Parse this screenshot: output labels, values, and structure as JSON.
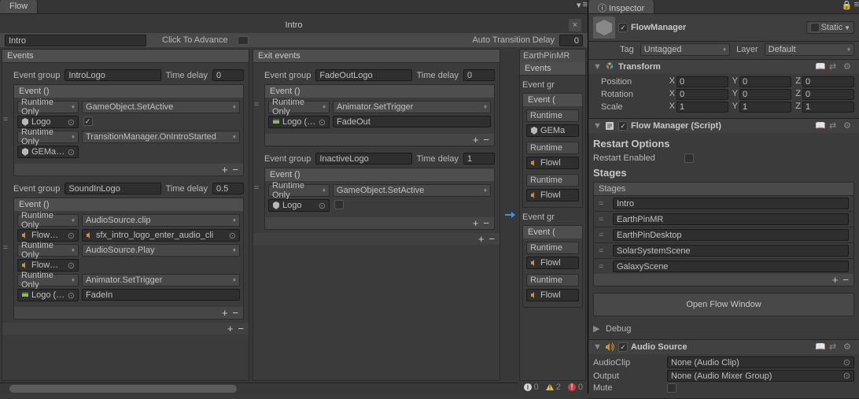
{
  "tabs": {
    "flow": "Flow",
    "inspector": "Inspector"
  },
  "flow": {
    "title": "Intro",
    "stage_name": "Intro",
    "click_advance_label": "Click To Advance",
    "auto_delay_label": "Auto Transition Delay",
    "auto_delay_value": "0",
    "events_header": "Events",
    "exit_events_header": "Exit events",
    "event_group_label": "Event group",
    "time_delay_label": "Time delay",
    "event_title": "Event ()",
    "runtime_only": "Runtime Only",
    "groups_left": [
      {
        "name": "IntroLogo",
        "delay": "0",
        "events": [
          {
            "func": "GameObject.SetActive",
            "obj": "Logo",
            "obj_icon": "cube",
            "param_type": "check",
            "param_checked": true
          },
          {
            "func": "TransitionManager.OnIntroStarted",
            "obj": "GEManage",
            "obj_icon": "cube",
            "param_type": "none"
          }
        ]
      },
      {
        "name": "SoundInLogo",
        "delay": "0.5",
        "events": [
          {
            "func": "AudioSource.clip",
            "obj": "FlowMana",
            "obj_icon": "audio",
            "param_type": "objref",
            "param": "sfx_intro_logo_enter_audio_cli",
            "param_icon": "audio"
          },
          {
            "func": "AudioSource.Play",
            "obj": "FlowMana",
            "obj_icon": "audio",
            "param_type": "none"
          },
          {
            "func": "Animator.SetTrigger",
            "obj": "Logo (Ani",
            "obj_icon": "anim",
            "param_type": "text",
            "param": "FadeIn"
          }
        ]
      }
    ],
    "groups_right": [
      {
        "name": "FadeOutLogo",
        "delay": "0",
        "events": [
          {
            "func": "Animator.SetTrigger",
            "obj": "Logo (Ani",
            "obj_icon": "anim",
            "param_type": "text",
            "param": "FadeOut"
          }
        ]
      },
      {
        "name": "InactiveLogo",
        "delay": "1",
        "events": [
          {
            "func": "GameObject.SetActive",
            "obj": "Logo",
            "obj_icon": "cube",
            "param_type": "check",
            "param_checked": false
          }
        ]
      }
    ],
    "partial": {
      "name": "EarthPinMR",
      "events_header": "Events",
      "event_gr": "Event gr",
      "event_title": "Event (",
      "runtime": "Runtime",
      "objs": [
        "GEMa",
        "Flowl",
        "Flowl",
        "Flowl",
        "Flowl"
      ]
    }
  },
  "status": {
    "info": "0",
    "warn": "2",
    "err": "0"
  },
  "inspector": {
    "name": "FlowManager",
    "static_label": "Static",
    "tag_label": "Tag",
    "tag_value": "Untagged",
    "layer_label": "Layer",
    "layer_value": "Default",
    "transform": {
      "title": "Transform",
      "position_label": "Position",
      "rotation_label": "Rotation",
      "scale_label": "Scale",
      "pos": {
        "x": "0",
        "y": "0",
        "z": "0"
      },
      "rot": {
        "x": "0",
        "y": "0",
        "z": "0"
      },
      "scl": {
        "x": "1",
        "y": "1",
        "z": "1"
      }
    },
    "flowmgr": {
      "title": "Flow Manager (Script)",
      "restart_options": "Restart Options",
      "restart_enabled_label": "Restart Enabled",
      "stages_title": "Stages",
      "stages_header": "Stages",
      "stages": [
        "Intro",
        "EarthPinMR",
        "EarthPinDesktop",
        "SolarSystemScene",
        "GalaxyScene"
      ],
      "open_btn": "Open Flow Window",
      "debug_label": "Debug"
    },
    "audio": {
      "title": "Audio Source",
      "audioclip_label": "AudioClip",
      "audioclip_value": "None (Audio Clip)",
      "output_label": "Output",
      "output_value": "None (Audio Mixer Group)",
      "mute_label": "Mute"
    }
  }
}
